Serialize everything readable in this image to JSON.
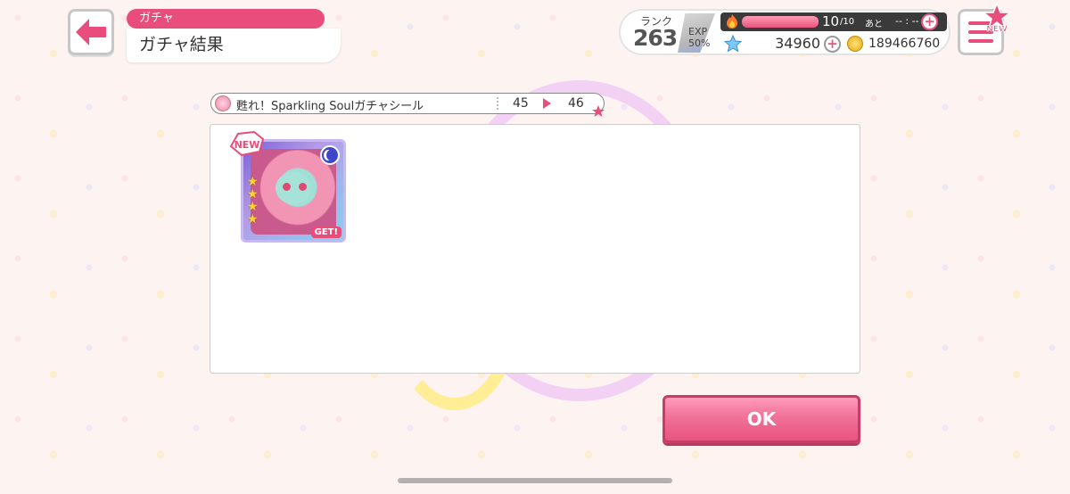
{
  "header": {
    "category": "ガチャ",
    "title": "ガチャ結果"
  },
  "status": {
    "rank_label": "ランク",
    "rank": "263",
    "exp_label": "EXP",
    "exp_percent": "50%",
    "stamina_current": "10",
    "stamina_max": "/10",
    "stamina_remaining_label": "あと",
    "stamina_timer": "-- : --",
    "star_gems": "34960",
    "coins": "189466760"
  },
  "menu": {
    "new_badge": "NEW"
  },
  "gacha": {
    "name": "甦れ！Sparkling Soulガチャシール",
    "count_before": "45",
    "count_after": "46"
  },
  "result": {
    "cards": [
      {
        "badge": "NEW",
        "rarity": 4,
        "attribute": "moon-icon",
        "get_label": "GET!"
      }
    ]
  },
  "actions": {
    "ok_label": "OK"
  },
  "colors": {
    "accent": "#e84d7c",
    "panel": "#ffffff"
  }
}
